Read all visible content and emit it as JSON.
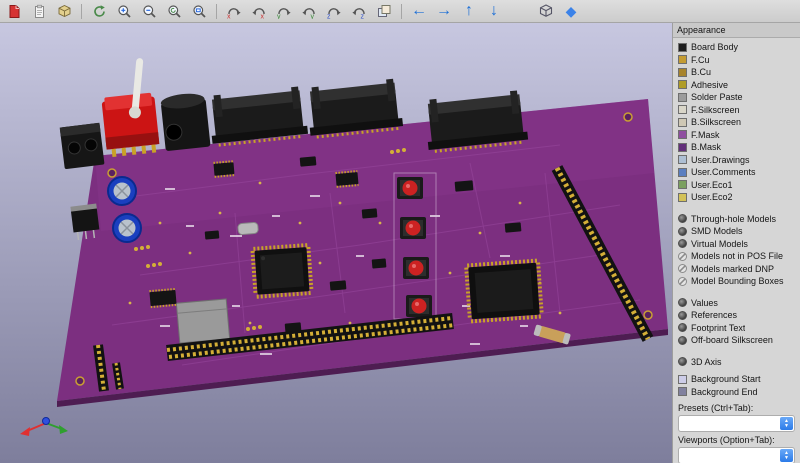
{
  "toolbar": {
    "icons": [
      "export-image",
      "copy-to-clipboard",
      "render-options",
      "redraw",
      "zoom-in",
      "zoom-out",
      "zoom-redraw",
      "zoom-to-fit",
      "rotate-x-clockwise",
      "rotate-x-counterclockwise",
      "rotate-y-clockwise",
      "rotate-y-counterclockwise",
      "rotate-z-clockwise",
      "rotate-z-counterclockwise",
      "flip-board",
      "move-left",
      "move-right",
      "move-up",
      "move-down",
      "orthographic-view",
      "perspective-view"
    ],
    "move_left_glyph": "←",
    "move_right_glyph": "→",
    "move_up_glyph": "↑",
    "move_down_glyph": "↓",
    "perspective_glyph": "◆"
  },
  "appearance": {
    "title": "Appearance",
    "layers": [
      {
        "label": "Board Body",
        "color": "#1e1e1e"
      },
      {
        "label": "F.Cu",
        "color": "#c49c33"
      },
      {
        "label": "B.Cu",
        "color": "#a8842c"
      },
      {
        "label": "Adhesive",
        "color": "#af9c27"
      },
      {
        "label": "Solder Paste",
        "color": "#9c9c9c"
      },
      {
        "label": "F.Silkscreen",
        "color": "#d9d6c9"
      },
      {
        "label": "B.Silkscreen",
        "color": "#cfc8b5"
      },
      {
        "label": "F.Mask",
        "color": "#8f4fa0"
      },
      {
        "label": "B.Mask",
        "color": "#63307a"
      },
      {
        "label": "User.Drawings",
        "color": "#aebfd3"
      },
      {
        "label": "User.Comments",
        "color": "#5b7fc0"
      },
      {
        "label": "User.Eco1",
        "color": "#7ba05f"
      },
      {
        "label": "User.Eco2",
        "color": "#d3c258"
      }
    ],
    "model_options": [
      {
        "label": "Through-hole Models",
        "state": "on"
      },
      {
        "label": "SMD Models",
        "state": "on"
      },
      {
        "label": "Virtual Models",
        "state": "on"
      },
      {
        "label": "Models not in POS File",
        "state": "off"
      },
      {
        "label": "Models marked DNP",
        "state": "off"
      },
      {
        "label": "Model Bounding Boxes",
        "state": "off"
      }
    ],
    "text_options": [
      {
        "label": "Values",
        "state": "on"
      },
      {
        "label": "References",
        "state": "on"
      },
      {
        "label": "Footprint Text",
        "state": "on"
      },
      {
        "label": "Off-board Silkscreen",
        "state": "on"
      }
    ],
    "misc_options": [
      {
        "label": "3D Axis",
        "state": "on"
      }
    ],
    "backgrounds": [
      {
        "label": "Background Start",
        "color": "#cdcde8"
      },
      {
        "label": "Background End",
        "color": "#81819f"
      }
    ],
    "presets_label": "Presets (Ctrl+Tab):",
    "presets_value": "",
    "viewports_label": "Viewports (Option+Tab):",
    "viewports_value": ""
  },
  "viewport": {
    "background_start": "#c7c7e0",
    "background_end": "#7e7e9c",
    "board_mask_color": "#7c2f80",
    "board_edge_color": "#4e1d52",
    "copper_color": "#d8b44a",
    "silkscreen_color": "#e8dcea"
  }
}
